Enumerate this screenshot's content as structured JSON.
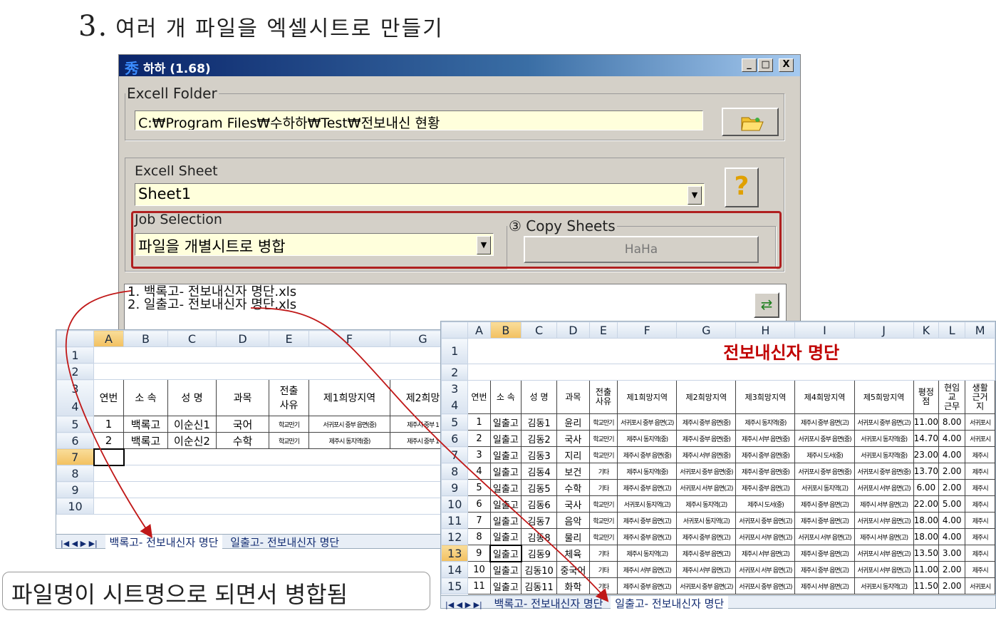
{
  "heading": {
    "number": "3.",
    "text": "여러 개 파일을 엑셀시트로 만들기"
  },
  "window": {
    "title": "하하 (1.68)",
    "icon": "秀",
    "controls": {
      "min": "_",
      "max": "□",
      "close": "X"
    },
    "folder": {
      "label": "Excell Folder",
      "path": "C:₩Program Files₩수하하₩Test₩전보내신 현황"
    },
    "sheet": {
      "label": "Excell Sheet",
      "value": "Sheet1"
    },
    "help": "?",
    "job": {
      "label": "Job Selection",
      "value": "파일을 개별시트로 병합"
    },
    "copy": {
      "label": "③ Copy Sheets",
      "button": "HaHa"
    },
    "files": [
      "1. 백록고- 전보내신자 명단.xls",
      "2. 일출고- 전보내신자 명단.xls"
    ]
  },
  "left_sheet": {
    "cols": [
      "A",
      "B",
      "C",
      "D",
      "E",
      "F",
      "G"
    ],
    "rows": [
      "1",
      "2",
      "3",
      "4",
      "5",
      "6",
      "7",
      "8",
      "9",
      "10"
    ],
    "headers": {
      "a": "연번",
      "b": "소  속",
      "c": "성 명",
      "d": "과목",
      "e": "전출\n사유",
      "f": "제1희망지역",
      "g": "제2희망"
    },
    "data": [
      [
        "1",
        "백록고",
        "이순신1",
        "국어",
        "학교만기",
        "서귀포시 중부 읍면(중)",
        "제주시 중부 1"
      ],
      [
        "2",
        "백록고",
        "이순신2",
        "수학",
        "학교만기",
        "제주시 동지역(중)",
        "제주시 중부 1"
      ]
    ],
    "tabs": [
      "백록고- 전보내신자 명단",
      "일출고- 전보내신자 명단"
    ]
  },
  "right_sheet": {
    "cols": [
      "A",
      "B",
      "C",
      "D",
      "E",
      "F",
      "G",
      "H",
      "I",
      "J",
      "K",
      "L",
      "M"
    ],
    "title": "전보내신자 명단",
    "headers": [
      "연번",
      "소  속",
      "성 명",
      "과목",
      "전출\n사유",
      "제1희망지역",
      "제2희망지역",
      "제3희망지역",
      "제4희망지역",
      "제5희망지역",
      "평정\n점",
      "현임\n교\n근무",
      "생활\n근거\n지"
    ],
    "rowlabels": [
      "1",
      "2",
      "3",
      "4",
      "5",
      "6",
      "7",
      "8",
      "9",
      "10",
      "11",
      "12",
      "13",
      "14",
      "15"
    ],
    "data": [
      [
        "1",
        "일출고",
        "김동1",
        "윤리",
        "학교만기",
        "서귀포시 중부 읍면(고)",
        "제주시 중부 읍면(중)",
        "제주시 동지역(중)",
        "제주시 중부 읍면(고)",
        "서귀포시 중부 읍면(고)",
        "11.00",
        "8.00",
        "서귀포시"
      ],
      [
        "2",
        "일출고",
        "김동2",
        "국사",
        "학교만기",
        "제주시 동지역(중)",
        "제주시 중부 읍면(중)",
        "제주시 서부 읍면(중)",
        "서귀포시 중부 읍면(중)",
        "서귀포시 동지역(중)",
        "14.70",
        "4.00",
        "서귀포시"
      ],
      [
        "3",
        "일출고",
        "김동3",
        "지리",
        "학교만기",
        "제주시 중부 읍면(중)",
        "제주시 서부 읍면(중)",
        "제주시 중부 읍면(중)",
        "제주시 도서(중)",
        "서귀포시 동지역(중)",
        "23.00",
        "4.00",
        "제주시"
      ],
      [
        "4",
        "일출고",
        "김동4",
        "보건",
        "기타",
        "제주시 동지역(중)",
        "서귀포시 중부 읍면(중)",
        "제주시 중부 읍면(중)",
        "서귀포시 중부 읍면(중)",
        "서귀포시 중부 읍면(중)",
        "13.70",
        "2.00",
        "제주시"
      ],
      [
        "5",
        "일출고",
        "김동5",
        "수학",
        "기타",
        "제주시 중부 읍면(고)",
        "서귀포시 서부 읍면(고)",
        "제주시 중부 읍면(고)",
        "서귀포시 동지역(고)",
        "서귀포시 서부 읍면(고)",
        "6.00",
        "2.00",
        "제주시"
      ],
      [
        "6",
        "일출고",
        "김동6",
        "국사",
        "학교만기",
        "서귀포시 동지역(고)",
        "제주시 동지역(고)",
        "제주시 도서(중)",
        "제주시 중부 읍면(고)",
        "제주시 서부 읍면(고)",
        "22.00",
        "5.00",
        "제주시"
      ],
      [
        "7",
        "일출고",
        "김동7",
        "음악",
        "학교만기",
        "제주시 중부 읍면(고)",
        "서귀포시 동지역(고)",
        "서귀포시 중부 읍면(고)",
        "제주시 중부 읍면(고)",
        "서귀포시 서부 읍면(고)",
        "18.00",
        "4.00",
        "제주시"
      ],
      [
        "8",
        "일출고",
        "김동8",
        "물리",
        "학교만기",
        "제주시 중부 읍면(고)",
        "제주시 중부 읍면(고)",
        "서귀포시 서부 읍면(고)",
        "서귀포시 서부 읍면(고)",
        "제주시 서부 읍면(고)",
        "18.00",
        "4.00",
        "제주시"
      ],
      [
        "9",
        "일출고",
        "김동9",
        "체육",
        "기타",
        "제주시 동지역(고)",
        "제주시 중부 읍면(고)",
        "제주시 서부 읍면(고)",
        "제주시 중부 읍면(고)",
        "서귀포시 서부 읍면(고)",
        "13.50",
        "3.00",
        "제주시"
      ],
      [
        "10",
        "일출고",
        "김동10",
        "중국어",
        "기타",
        "제주시 서부 읍면(고)",
        "제주시 서부 읍면(고)",
        "서귀포시 서부 읍면(고)",
        "제주시 중부 읍면(고)",
        "서귀포시 서부 읍면(고)",
        "11.00",
        "2.00",
        "제주시"
      ],
      [
        "11",
        "일출고",
        "김동11",
        "화학",
        "기타",
        "제주시 중부 읍면(고)",
        "서귀포시 중부 읍면(고)",
        "서귀포시 중부 읍면(고)",
        "제주시 서부 읍면(고)",
        "서귀포시 동지역(고)",
        "11.50",
        "2.00",
        "서귀포시"
      ]
    ],
    "tabs": [
      "백록고- 전보내신자 명단",
      "일출고- 전보내신자 명단"
    ]
  },
  "caption": "파일명이 시트명으로 되면서 병합됨",
  "colors": {
    "accent_red": "#b02020",
    "arrow": "#c01818",
    "title_red": "#c00000"
  }
}
